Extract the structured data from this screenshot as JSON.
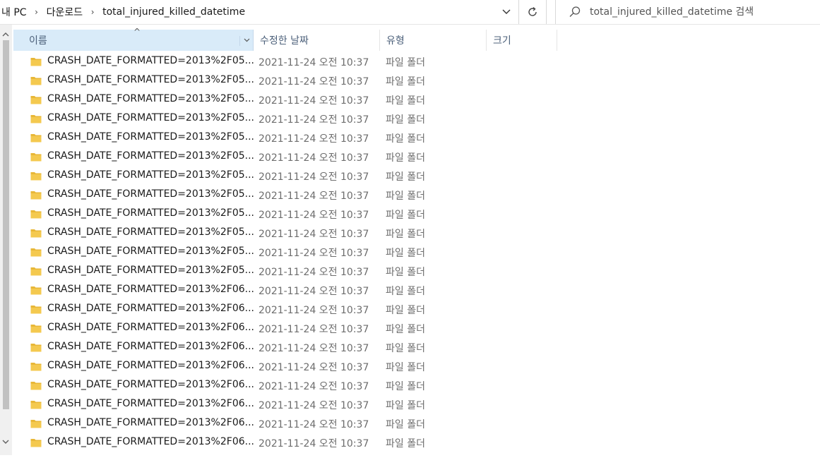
{
  "breadcrumb": [
    "내 PC",
    "다운로드",
    "total_injured_killed_datetime"
  ],
  "search": {
    "placeholder": "total_injured_killed_datetime 검색"
  },
  "columns": {
    "name": "이름",
    "date": "수정한 날짜",
    "type": "유형",
    "size": "크기"
  },
  "colors": {
    "header_selected": "#d9ebf9",
    "folder": "#f4c94f",
    "header_text": "#4c607a"
  },
  "rows": [
    {
      "name": "CRASH_DATE_FORMATTED=2013%2F05...",
      "date": "2021-11-24 오전 10:37",
      "type": "파일 폴더"
    },
    {
      "name": "CRASH_DATE_FORMATTED=2013%2F05...",
      "date": "2021-11-24 오전 10:37",
      "type": "파일 폴더"
    },
    {
      "name": "CRASH_DATE_FORMATTED=2013%2F05...",
      "date": "2021-11-24 오전 10:37",
      "type": "파일 폴더"
    },
    {
      "name": "CRASH_DATE_FORMATTED=2013%2F05...",
      "date": "2021-11-24 오전 10:37",
      "type": "파일 폴더"
    },
    {
      "name": "CRASH_DATE_FORMATTED=2013%2F05...",
      "date": "2021-11-24 오전 10:37",
      "type": "파일 폴더"
    },
    {
      "name": "CRASH_DATE_FORMATTED=2013%2F05...",
      "date": "2021-11-24 오전 10:37",
      "type": "파일 폴더"
    },
    {
      "name": "CRASH_DATE_FORMATTED=2013%2F05...",
      "date": "2021-11-24 오전 10:37",
      "type": "파일 폴더"
    },
    {
      "name": "CRASH_DATE_FORMATTED=2013%2F05...",
      "date": "2021-11-24 오전 10:37",
      "type": "파일 폴더"
    },
    {
      "name": "CRASH_DATE_FORMATTED=2013%2F05...",
      "date": "2021-11-24 오전 10:37",
      "type": "파일 폴더"
    },
    {
      "name": "CRASH_DATE_FORMATTED=2013%2F05...",
      "date": "2021-11-24 오전 10:37",
      "type": "파일 폴더"
    },
    {
      "name": "CRASH_DATE_FORMATTED=2013%2F05...",
      "date": "2021-11-24 오전 10:37",
      "type": "파일 폴더"
    },
    {
      "name": "CRASH_DATE_FORMATTED=2013%2F05...",
      "date": "2021-11-24 오전 10:37",
      "type": "파일 폴더"
    },
    {
      "name": "CRASH_DATE_FORMATTED=2013%2F06...",
      "date": "2021-11-24 오전 10:37",
      "type": "파일 폴더"
    },
    {
      "name": "CRASH_DATE_FORMATTED=2013%2F06...",
      "date": "2021-11-24 오전 10:37",
      "type": "파일 폴더"
    },
    {
      "name": "CRASH_DATE_FORMATTED=2013%2F06...",
      "date": "2021-11-24 오전 10:37",
      "type": "파일 폴더"
    },
    {
      "name": "CRASH_DATE_FORMATTED=2013%2F06...",
      "date": "2021-11-24 오전 10:37",
      "type": "파일 폴더"
    },
    {
      "name": "CRASH_DATE_FORMATTED=2013%2F06...",
      "date": "2021-11-24 오전 10:37",
      "type": "파일 폴더"
    },
    {
      "name": "CRASH_DATE_FORMATTED=2013%2F06...",
      "date": "2021-11-24 오전 10:37",
      "type": "파일 폴더"
    },
    {
      "name": "CRASH_DATE_FORMATTED=2013%2F06...",
      "date": "2021-11-24 오전 10:37",
      "type": "파일 폴더"
    },
    {
      "name": "CRASH_DATE_FORMATTED=2013%2F06...",
      "date": "2021-11-24 오전 10:37",
      "type": "파일 폴더"
    },
    {
      "name": "CRASH_DATE_FORMATTED=2013%2F06...",
      "date": "2021-11-24 오전 10:37",
      "type": "파일 폴더"
    }
  ]
}
